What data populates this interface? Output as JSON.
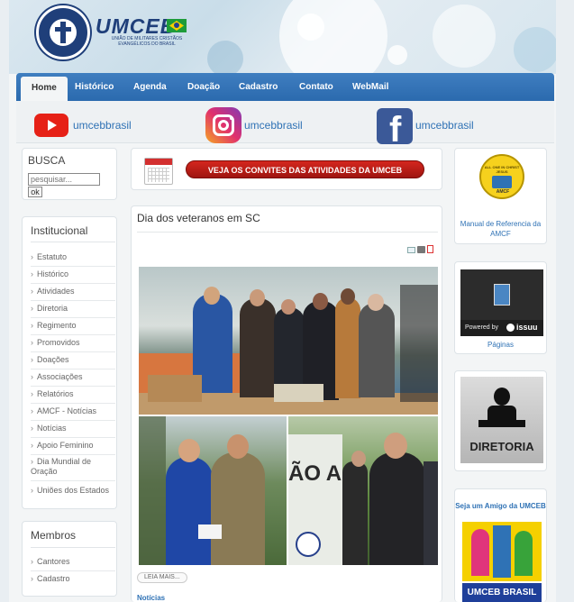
{
  "nav": {
    "items": [
      "Home",
      "Histórico",
      "Agenda",
      "Doação",
      "Cadastro",
      "Contato",
      "WebMail"
    ]
  },
  "header": {
    "brand": "UMCEB",
    "subtitle": "UNIÃO DE MILITARES CRISTÃOS EVANGÉLICOS DO BRASIL"
  },
  "social": {
    "youtube": "umcebbrasil",
    "instagram": "umcebbrasil",
    "facebook": "umcebbrasil"
  },
  "search": {
    "title": "BUSCA",
    "placeholder": "pesquisar...",
    "button": "ok"
  },
  "institucional": {
    "title": "Institucional",
    "items": [
      "Estatuto",
      "Histórico",
      "Atividades",
      "Diretoria",
      "Regimento",
      "Promovidos",
      "Doações",
      "Associações",
      "Relatórios",
      "AMCF - Notícias",
      "Notícias",
      "Apoio Feminino",
      "Dia Mundial de Oração",
      "Uniões dos Estados"
    ]
  },
  "membros": {
    "title": "Membros",
    "items": [
      "Cantores",
      "Cadastro"
    ]
  },
  "banner": {
    "label": "VEJA OS CONVITES DAS ATIVIDADES DA UMCEB"
  },
  "article": {
    "title": "Dia dos veteranos em SC",
    "read_more": "LEIA MAIS...",
    "category": "Notícias",
    "photo_text": "ÃO A"
  },
  "right": {
    "amcf_link": "Manual de Referencia da AMCF",
    "amcf_badge": "ALL ONE IN CHRIST JESUS",
    "amcf_abbr": "AMCF",
    "issuu_powered": "Powered by",
    "issuu_brand": "issuu",
    "issuu_link": "Páginas",
    "diretoria": "DIRETORIA",
    "friend_title": "Seja um Amigo da UMCEB",
    "friend_banner": "UMCEB BRASIL"
  },
  "colors": {
    "nav_blue": "#2b6aae",
    "link_blue": "#2f72b5",
    "banner_red": "#c8231b"
  }
}
